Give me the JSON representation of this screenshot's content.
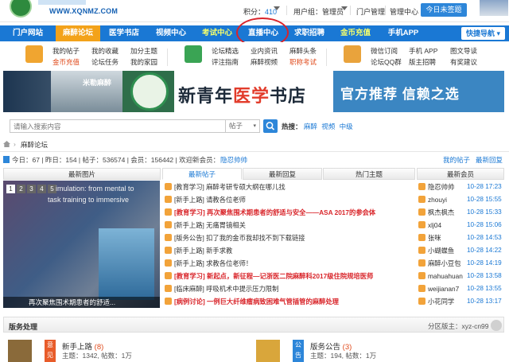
{
  "site": {
    "domain": "WWW.XQNMZ.COM"
  },
  "topbar": {
    "score_label": "积分：",
    "score_value": "410",
    "user_label": "用户组：管理员",
    "portal_admin": "门户管理",
    "mgmt_center": "管理中心",
    "signin_button": "今日未签题"
  },
  "nav": {
    "items": [
      {
        "label": "门户网站"
      },
      {
        "label": "麻醉论坛"
      },
      {
        "label": "医学书店"
      },
      {
        "label": "视频中心"
      },
      {
        "label": "考试中心"
      },
      {
        "label": "直播中心"
      },
      {
        "label": "求职招聘"
      },
      {
        "label": "金币充值"
      },
      {
        "label": "手机APP"
      }
    ],
    "quick_nav": "快捷导航"
  },
  "subnav": {
    "group1": [
      "我的帖子",
      "我的收藏",
      "加分主题",
      "金币充值",
      "论坛任务",
      "我的家园"
    ],
    "group2": [
      "论坛精选",
      "业内资讯",
      "麻醉头条",
      "评注指南",
      "麻醉视频",
      "职称考试"
    ],
    "group3": [
      "微信订阅",
      "手机 APP",
      "图文导读",
      "论坛QQ群",
      "版主招聘",
      "有奖建议"
    ]
  },
  "banner": {
    "left_text": "米勒麻醉",
    "title_a": "新青年",
    "title_b": "医学",
    "title_c": "书店",
    "slogan": "官方推荐 信赖之选"
  },
  "search": {
    "placeholder": "请输入搜索内容",
    "select": "帖子",
    "hot_label": "热搜：",
    "hot_terms": [
      "麻醉",
      "视频",
      "中级"
    ]
  },
  "breadcrumb": {
    "item": "麻醉论坛"
  },
  "stats": {
    "text": "今日：67 | 昨日：154 | 帖子：536574 | 会员：156442 | 欢迎新会员：",
    "new_member": "隐忍帅帅",
    "my_posts": "我的帖子",
    "latest_reply": "最新回复"
  },
  "tabs": {
    "images": "最新图片",
    "posts": "最新帖子",
    "replies": "最新回复",
    "hot": "热门主题",
    "members": "最新会员"
  },
  "slideshow": {
    "pages": [
      "1",
      "2",
      "3",
      "4",
      "5"
    ],
    "caption_top": "imulation: from mental to",
    "caption_mid": "task training to immersive",
    "caption_bottom": "再次聚焦围术期患者的舒适..."
  },
  "posts": [
    {
      "title": "[教育学习] 麻醉考研专硕大纲在哪儿找",
      "red": false
    },
    {
      "title": "[新手上路] 请教各位老师",
      "red": false
    },
    {
      "title": "[教育学习] 再次聚焦围术期患者的舒适与安全——ASA 2017的参会体",
      "red": true
    },
    {
      "title": "[新手上路] 无痛胃镜相关",
      "red": false
    },
    {
      "title": "[版务公告] 扣了我的金币我却找不到下载链接",
      "red": false
    },
    {
      "title": "[新手上路] 新手求教",
      "red": false
    },
    {
      "title": "[新手上路] 求教各位老师！",
      "red": false
    },
    {
      "title": "[教育学习] 新起点，新征程—记浙医二院麻醉科2017级住院规培医师",
      "red": true
    },
    {
      "title": "[临床麻醉] 呼吸机术中提示压力限制",
      "red": false
    },
    {
      "title": "[病例讨论] 一例巨大纤维瘤病致困难气管插管的麻醉处理",
      "red": true
    }
  ],
  "members": [
    {
      "name": "隐忍帅帅",
      "time": "10-28 17:23"
    },
    {
      "name": "zhouyi",
      "time": "10-28 15:55"
    },
    {
      "name": "枫杰枫杰",
      "time": "10-28 15:33"
    },
    {
      "name": "xlj04",
      "time": "10-28 15:06"
    },
    {
      "name": "张咪",
      "time": "10-28 14:53"
    },
    {
      "name": "小蝴蝶鱼",
      "time": "10-28 14:22"
    },
    {
      "name": "麻醉小豆包",
      "time": "10-28 14:19"
    },
    {
      "name": "mahuahuan",
      "time": "10-28 13:58"
    },
    {
      "name": "weijianan7",
      "time": "10-28 13:55"
    },
    {
      "name": "小花同学",
      "time": "10-28 13:17"
    }
  ],
  "section": {
    "title": "版务处理",
    "moderator": "分区版主：xyz-cn99",
    "forums": [
      {
        "name": "新手上路",
        "count": "(8)",
        "stats": "主题：1342, 帖数：1万",
        "badge": "意见"
      },
      {
        "name": "版务公告",
        "count": "(3)",
        "stats": "主题：194, 帖数：1万",
        "badge": "公告"
      }
    ]
  }
}
